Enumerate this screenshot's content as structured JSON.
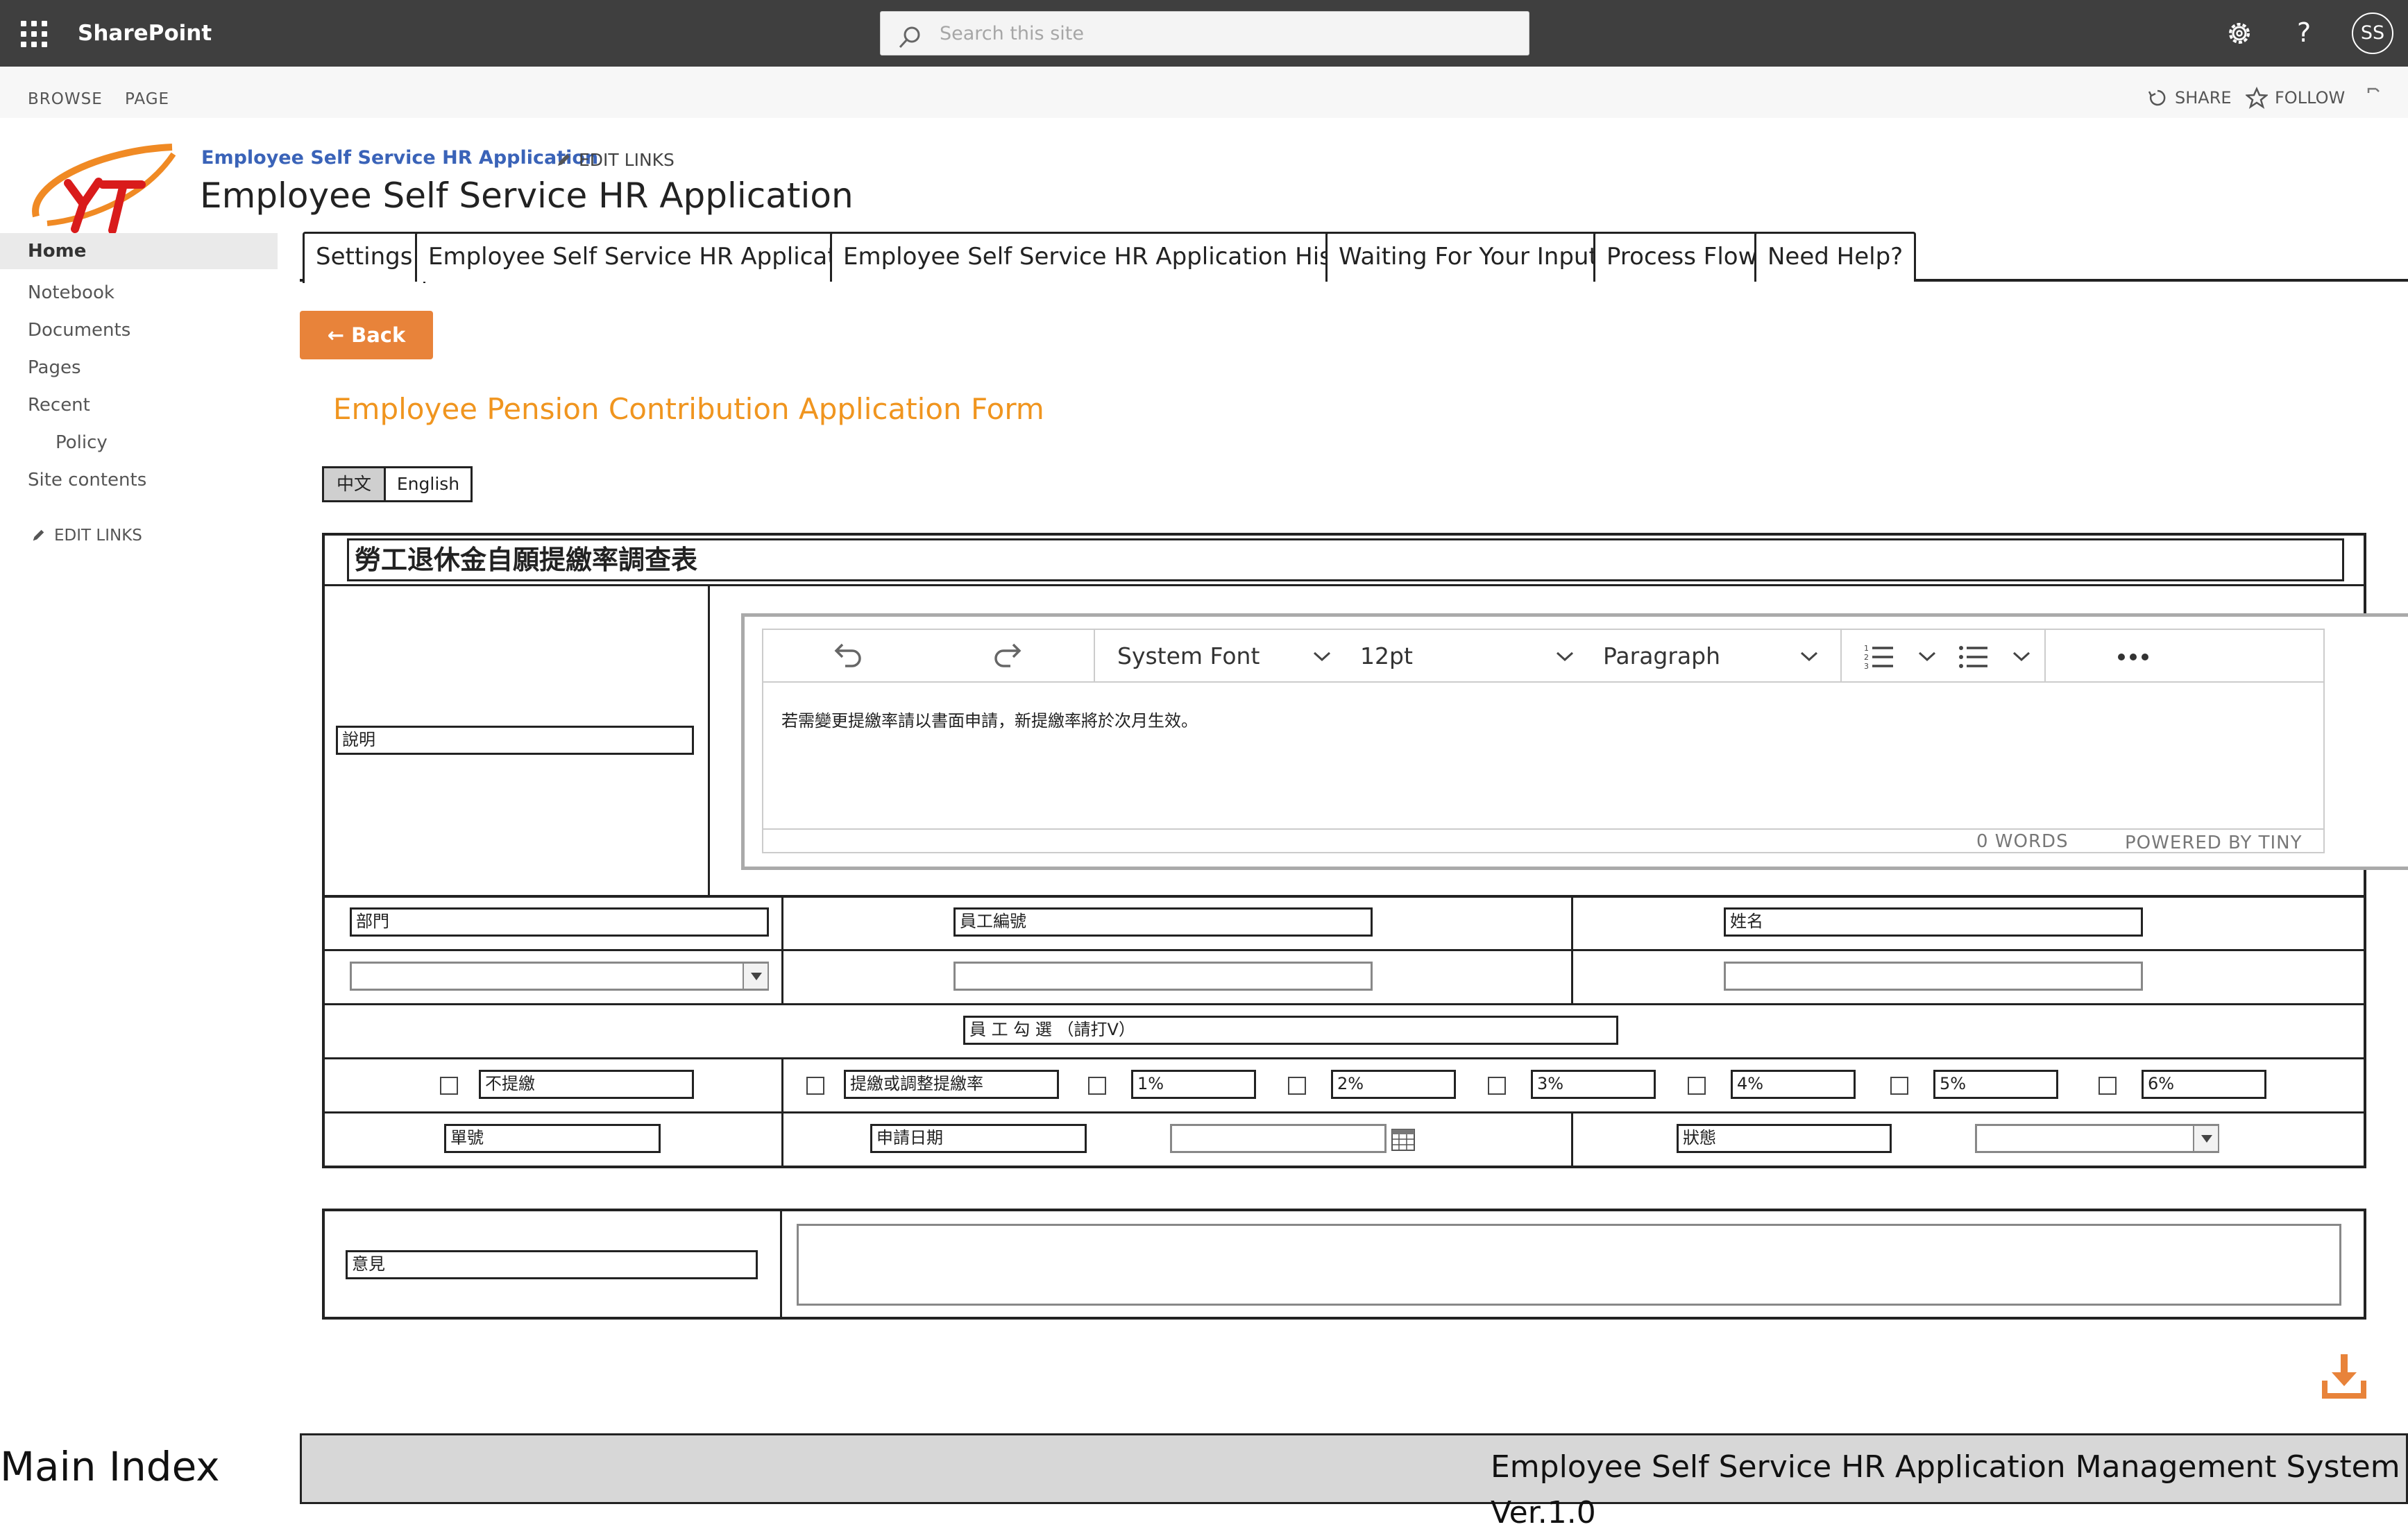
{
  "suite": {
    "brand": "SharePoint",
    "search_placeholder": "Search this site",
    "avatar_initials": "SS"
  },
  "ribbon": {
    "tabs": [
      "BROWSE",
      "PAGE"
    ],
    "share": "SHARE",
    "follow": "FOLLOW"
  },
  "header": {
    "site_link": "Employee Self Service HR Application",
    "edit_links": "EDIT LINKS",
    "title": "Employee Self Service HR Application"
  },
  "nav": {
    "items": [
      "Home",
      "Notebook",
      "Documents",
      "Pages",
      "Recent",
      "Policy",
      "Site contents"
    ],
    "edit_links": "EDIT LINKS"
  },
  "tabs": [
    "Settings",
    "Employee Self Service HR Application",
    "Employee Self Service HR Application History",
    "Waiting For Your Input",
    "Process Flow",
    "Need Help?"
  ],
  "page": {
    "back_label": "Back",
    "form_title": "Employee Pension Contribution Application Form"
  },
  "lang": {
    "zh": "中文",
    "en": "English"
  },
  "form": {
    "title": "勞工退休金自願提繳率調查表",
    "description_label": "說明",
    "editor": {
      "font": "System Font",
      "size": "12pt",
      "block": "Paragraph",
      "content": "若需變更提繳率請以書面申請，新提繳率將於次月生效。",
      "word_count": "0 WORDS",
      "powered_by": "POWERED BY TINY"
    },
    "department_label": "部門",
    "employee_id_label": "員工編號",
    "name_label": "姓名",
    "selection_header": "員 工 勾 選 （請打V）",
    "no_contribution": "不提繳",
    "adjust_rate": "提繳或調整提繳率",
    "rates": [
      "1%",
      "2%",
      "3%",
      "4%",
      "5%",
      "6%"
    ],
    "serial_label": "單號",
    "apply_date_label": "申請日期",
    "status_label": "狀態",
    "opinion_label": "意見"
  },
  "footer": {
    "left": "Main Index",
    "right": "Employee Self Service HR Application Management System Ver.1.0"
  },
  "colors": {
    "suitebar": "#3f3f3f",
    "accent_orange": "#e8833a",
    "title_orange": "#f0951f",
    "link_blue": "#3a63b8",
    "footer_gray": "#d7d7d7"
  }
}
